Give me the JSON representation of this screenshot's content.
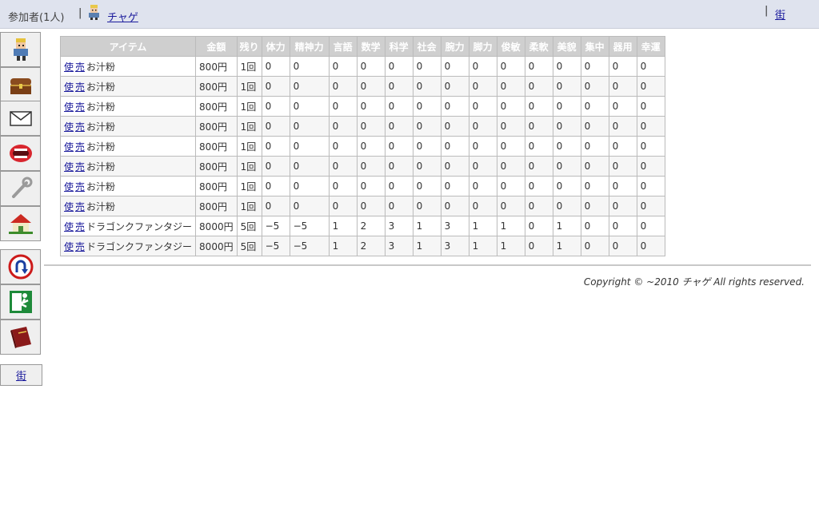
{
  "topbar": {
    "participants": "参加者(1人)",
    "separator": "|",
    "username": "チャゲ",
    "town_link": "街"
  },
  "sidebar": {
    "icons": [
      "avatar-icon",
      "treasure-chest-icon",
      "mail-icon",
      "mouth-icon",
      "wrench-icon",
      "house-icon",
      "u-turn-icon",
      "exit-icon",
      "book-icon"
    ],
    "town_button": "街"
  },
  "table": {
    "headers": [
      "アイテム",
      "金額",
      "残り",
      "体力",
      "精神力",
      "言語",
      "数学",
      "科学",
      "社会",
      "腕力",
      "脚力",
      "俊敏",
      "柔軟",
      "美貌",
      "集中",
      "器用",
      "幸運"
    ],
    "use_label": "使",
    "sell_label": "売",
    "rows": [
      {
        "name": "お汁粉",
        "price": "800円",
        "remain": "1回",
        "stats": [
          "0",
          "0",
          "0",
          "0",
          "0",
          "0",
          "0",
          "0",
          "0",
          "0",
          "0",
          "0",
          "0",
          "0"
        ]
      },
      {
        "name": "お汁粉",
        "price": "800円",
        "remain": "1回",
        "stats": [
          "0",
          "0",
          "0",
          "0",
          "0",
          "0",
          "0",
          "0",
          "0",
          "0",
          "0",
          "0",
          "0",
          "0"
        ]
      },
      {
        "name": "お汁粉",
        "price": "800円",
        "remain": "1回",
        "stats": [
          "0",
          "0",
          "0",
          "0",
          "0",
          "0",
          "0",
          "0",
          "0",
          "0",
          "0",
          "0",
          "0",
          "0"
        ]
      },
      {
        "name": "お汁粉",
        "price": "800円",
        "remain": "1回",
        "stats": [
          "0",
          "0",
          "0",
          "0",
          "0",
          "0",
          "0",
          "0",
          "0",
          "0",
          "0",
          "0",
          "0",
          "0"
        ]
      },
      {
        "name": "お汁粉",
        "price": "800円",
        "remain": "1回",
        "stats": [
          "0",
          "0",
          "0",
          "0",
          "0",
          "0",
          "0",
          "0",
          "0",
          "0",
          "0",
          "0",
          "0",
          "0"
        ]
      },
      {
        "name": "お汁粉",
        "price": "800円",
        "remain": "1回",
        "stats": [
          "0",
          "0",
          "0",
          "0",
          "0",
          "0",
          "0",
          "0",
          "0",
          "0",
          "0",
          "0",
          "0",
          "0"
        ]
      },
      {
        "name": "お汁粉",
        "price": "800円",
        "remain": "1回",
        "stats": [
          "0",
          "0",
          "0",
          "0",
          "0",
          "0",
          "0",
          "0",
          "0",
          "0",
          "0",
          "0",
          "0",
          "0"
        ]
      },
      {
        "name": "お汁粉",
        "price": "800円",
        "remain": "1回",
        "stats": [
          "0",
          "0",
          "0",
          "0",
          "0",
          "0",
          "0",
          "0",
          "0",
          "0",
          "0",
          "0",
          "0",
          "0"
        ]
      },
      {
        "name": "ドラゴンクファンタジー",
        "price": "8000円",
        "remain": "5回",
        "stats": [
          "−5",
          "−5",
          "1",
          "2",
          "3",
          "1",
          "3",
          "1",
          "1",
          "0",
          "1",
          "0",
          "0",
          "0"
        ]
      },
      {
        "name": "ドラゴンクファンタジー",
        "price": "8000円",
        "remain": "5回",
        "stats": [
          "−5",
          "−5",
          "1",
          "2",
          "3",
          "1",
          "3",
          "1",
          "1",
          "0",
          "1",
          "0",
          "0",
          "0"
        ]
      }
    ]
  },
  "footer": {
    "copyright": "Copyright © ~2010 チャゲ All rights reserved."
  }
}
